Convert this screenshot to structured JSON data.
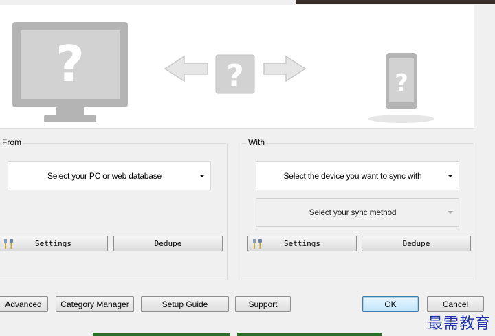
{
  "banner": {
    "source_icon": "desktop-monitor-question-icon",
    "sync_icon": "bidirectional-arrows-question-icon",
    "target_icon": "phone-question-icon",
    "glyph": "?"
  },
  "from": {
    "legend": "From",
    "dropdown": {
      "label": "Select your PC or web database"
    },
    "settings_label": "Settings",
    "dedupe_label": "Dedupe"
  },
  "with": {
    "legend": "With",
    "device_dropdown": {
      "label": "Select the device you want to sync with"
    },
    "method_dropdown": {
      "label": "Select your sync method",
      "disabled": true
    },
    "settings_label": "Settings",
    "dedupe_label": "Dedupe"
  },
  "footer": {
    "advanced": "Advanced",
    "category_manager": "Category Manager",
    "setup_guide": "Setup Guide",
    "support": "Support",
    "ok": "OK",
    "cancel": "Cancel"
  },
  "watermark": "最需教育",
  "colors": {
    "icon_gray": "#b4b4b4",
    "watermark": "#1a2fa8",
    "default_button_border": "#3c7fb1"
  }
}
